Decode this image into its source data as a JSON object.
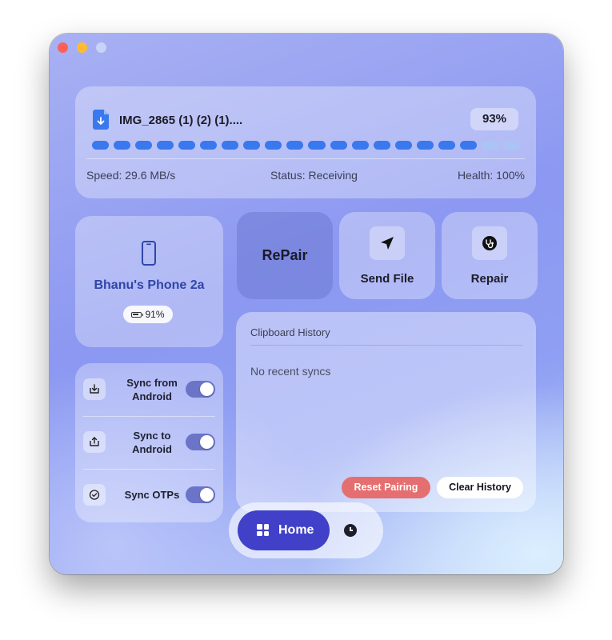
{
  "window": {
    "controls": [
      "close",
      "minimize",
      "maximize"
    ]
  },
  "transfer": {
    "file_icon": "file-download-icon",
    "file_name": "IMG_2865 (1) (2) (1)....",
    "percent_label": "93%",
    "progress_fraction": 0.93,
    "segments_total": 20,
    "segments_filled": 18,
    "speed": "Speed: 29.6 MB/s",
    "status": "Status: Receiving",
    "health": "Health: 100%"
  },
  "device": {
    "icon": "phone-icon",
    "name": "Bhanu's Phone 2a",
    "battery": "91%"
  },
  "actions": {
    "brand": "RePair",
    "send_file": {
      "label": "Send File",
      "icon": "paper-plane-icon"
    },
    "repair": {
      "label": "Repair",
      "icon": "stethoscope-icon"
    }
  },
  "sync": {
    "items": [
      {
        "label": "Sync from Android",
        "icon": "download-tray-icon",
        "enabled": true
      },
      {
        "label": "Sync to Android",
        "icon": "upload-tray-icon",
        "enabled": true
      },
      {
        "label": "Sync OTPs",
        "icon": "check-badge-icon",
        "enabled": true
      }
    ]
  },
  "clipboard": {
    "title": "Clipboard History",
    "empty_text": "No recent syncs",
    "reset_label": "Reset Pairing",
    "clear_label": "Clear History"
  },
  "nav": {
    "home_label": "Home",
    "home_icon": "grid-icon",
    "history_icon": "clock-icon"
  },
  "colors": {
    "segment_filled": "#3a78ee",
    "segment_empty": "#aac4f6",
    "nav_active": "#4041c8",
    "toggle_on": "#6c74c8",
    "reset_button": "#e56f70",
    "device_name": "#2f46a8"
  }
}
